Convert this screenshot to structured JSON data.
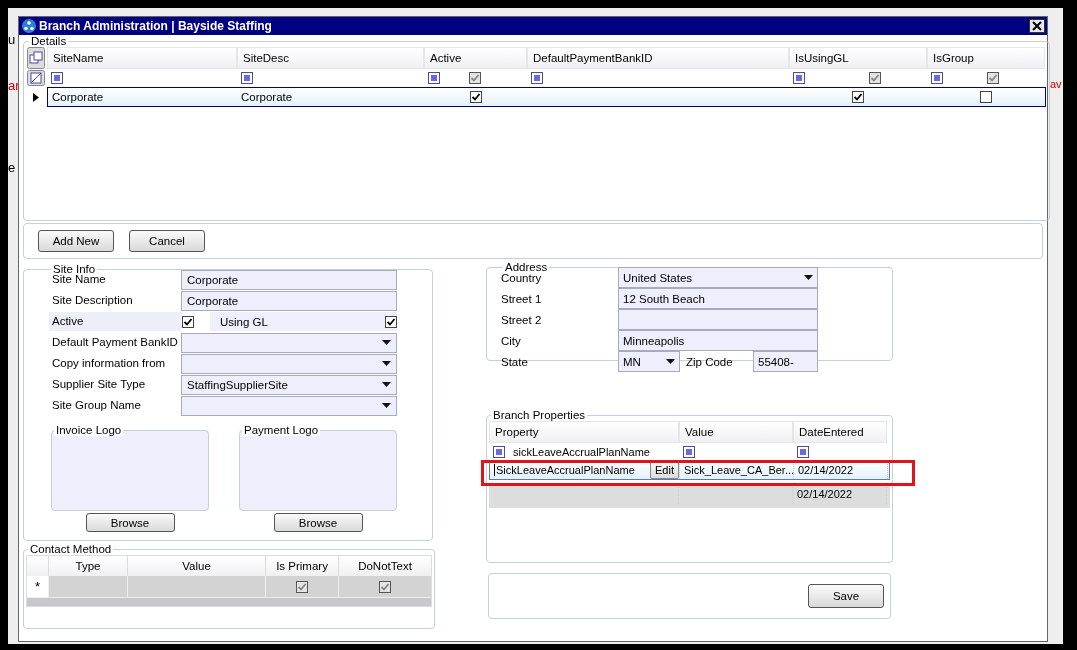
{
  "background_app": {
    "texts": [
      "u",
      "ar",
      "e",
      "av"
    ]
  },
  "window": {
    "title": "Branch Administration | Bayside Staffing"
  },
  "details": {
    "legend": "Details",
    "columns": [
      {
        "label": "SiteName",
        "kind": "text"
      },
      {
        "label": "SiteDesc",
        "kind": "text"
      },
      {
        "label": "Active",
        "kind": "bool",
        "filter_checked": true
      },
      {
        "label": "DefaultPaymentBankID",
        "kind": "text"
      },
      {
        "label": "IsUsingGL",
        "kind": "bool",
        "filter_checked": true
      },
      {
        "label": "IsGroup",
        "kind": "bool",
        "filter_checked": true
      }
    ],
    "rows": [
      {
        "selected": true,
        "cells": [
          "Corporate",
          "Corporate",
          true,
          "",
          true,
          false
        ]
      }
    ]
  },
  "buttons": [
    "Add New",
    "Cancel"
  ],
  "site_info": {
    "legend": "Site Info",
    "fields": [
      {
        "label": "Site Name",
        "kind": "text",
        "value": "Corporate"
      },
      {
        "label": "Site Description",
        "kind": "text",
        "value": "Corporate"
      },
      {
        "label": "Active",
        "kind": "checks",
        "checked": true,
        "label2": "Using GL",
        "checked2": true
      },
      {
        "label": "Default Payment BankID",
        "kind": "select"
      },
      {
        "label": "Copy information from",
        "kind": "select"
      },
      {
        "label": "Supplier Site Type",
        "kind": "select",
        "value": "StaffingSupplierSite"
      },
      {
        "label": "Site Group Name",
        "kind": "select"
      }
    ],
    "logos": [
      {
        "legend": "Invoice Logo",
        "button": "Browse"
      },
      {
        "legend": "Payment Logo",
        "button": "Browse"
      }
    ]
  },
  "contact_method": {
    "legend": "Contact Method",
    "columns": [
      {
        "label": "Type",
        "kind": "text"
      },
      {
        "label": "Value",
        "kind": "text"
      },
      {
        "label": "Is Primary",
        "kind": "bool",
        "new_row_checked": true
      },
      {
        "label": "DoNotText",
        "kind": "bool",
        "new_row_checked": true
      }
    ],
    "new_row_marker": "*"
  },
  "address": {
    "legend": "Address",
    "fields": [
      {
        "label": "Country",
        "kind": "select",
        "value": "United States"
      },
      {
        "label": "Street 1",
        "kind": "text",
        "value": "12 South Beach"
      },
      {
        "label": "Street 2",
        "kind": "text"
      },
      {
        "label": "City",
        "kind": "text",
        "value": "Minneapolis"
      },
      {
        "label": "State",
        "kind": "state",
        "value": "MN",
        "zip_label": "Zip Code",
        "zip_value": "55408-"
      }
    ]
  },
  "branch_properties": {
    "legend": "Branch Properties",
    "columns": [
      "Property",
      "Value",
      "DateEntered"
    ],
    "filter_text": "sickLeaveAccrualPlanName",
    "rows": [
      {
        "selected": true,
        "property": "SickLeaveAccrualPlanName",
        "edit_button": "Edit",
        "value": "Sick_Leave_CA_Ber...",
        "date": "02/14/2022"
      },
      {
        "selected": false,
        "date": "02/14/2022"
      }
    ]
  },
  "save_button": "Save"
}
